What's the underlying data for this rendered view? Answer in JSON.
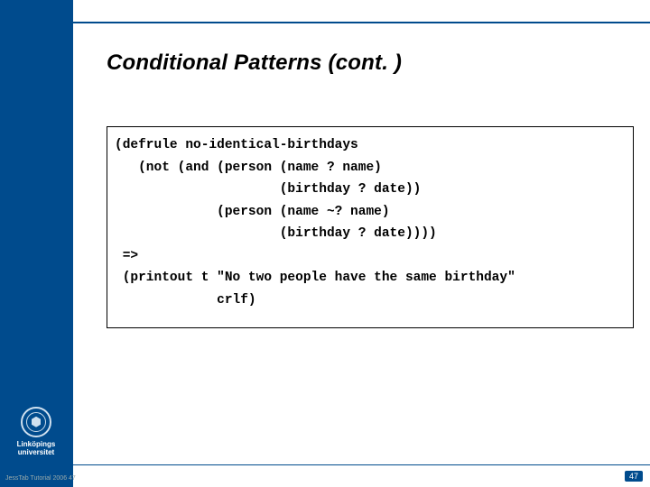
{
  "title": "Conditional Patterns (cont. )",
  "code": {
    "l1": "(defrule no-identical-birthdays",
    "l2": "   (not (and (person (name ? name)",
    "l3": "                     (birthday ? date))",
    "l4": "             (person (name ~? name)",
    "l5": "                     (birthday ? date))))",
    "l6": " =>",
    "l7": " (printout t \"No two people have the same birthday\"",
    "l8": "             crlf)"
  },
  "university": "Linköpings universitet",
  "footer": {
    "left": "JessTab Tutorial 2006",
    "num": "47",
    "badge": "47"
  }
}
